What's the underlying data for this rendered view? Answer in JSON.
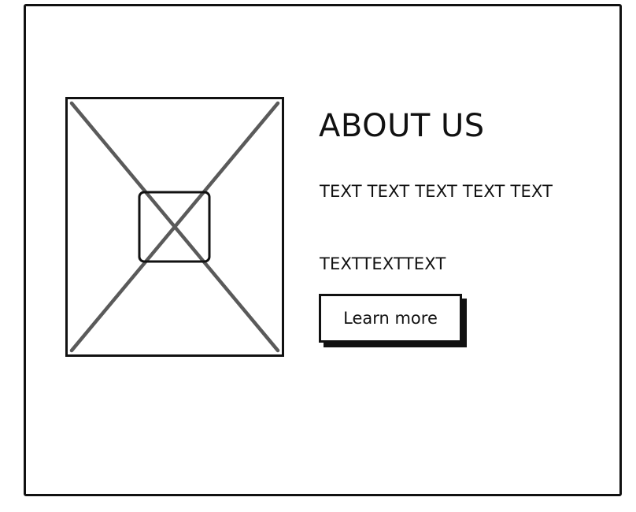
{
  "about": {
    "title": "ABOUT US",
    "paragraphs": [
      "TEXT TEXT TEXT TEXT TEXT",
      "TEXTTEXTTEXT"
    ],
    "button_label": "Learn more"
  },
  "image_placeholder": {
    "icon": "image-placeholder-icon"
  }
}
